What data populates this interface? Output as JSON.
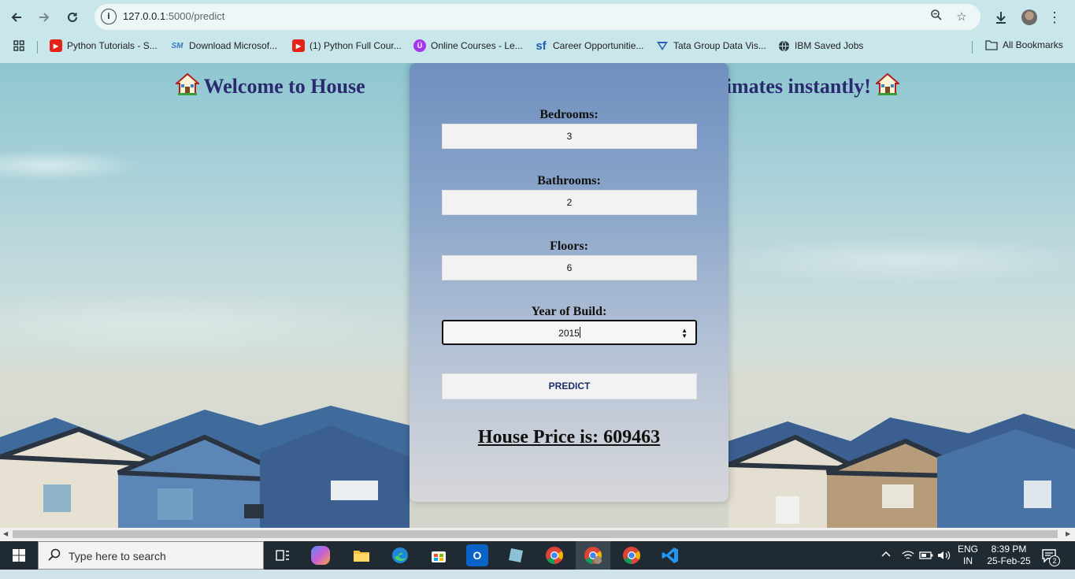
{
  "browser": {
    "url_host": "127.0.0.1",
    "url_path": ":5000/predict",
    "bookmarks": [
      {
        "label": "Python Tutorials - S...",
        "icon": "youtube-icon"
      },
      {
        "label": "Download Microsof...",
        "icon": "sm-icon",
        "icon_text": "SM"
      },
      {
        "label": "(1) Python Full Cour...",
        "icon": "youtube-icon"
      },
      {
        "label": "Online Courses - Le...",
        "icon": "udemy-icon"
      },
      {
        "label": "Career Opportunitie...",
        "icon": "sf-icon",
        "icon_text": "sf"
      },
      {
        "label": "Tata Group Data Vis...",
        "icon": "tata-icon"
      },
      {
        "label": "IBM Saved Jobs",
        "icon": "globe-icon"
      }
    ],
    "all_bookmarks": "All Bookmarks"
  },
  "page": {
    "heading_left": "Welcome to House",
    "heading_right": "ice estimates instantly!",
    "form": {
      "bedrooms_label": "Bedrooms:",
      "bedrooms_value": "3",
      "bathrooms_label": "Bathrooms:",
      "bathrooms_value": "2",
      "floors_label": "Floors:",
      "floors_value": "6",
      "year_label": "Year of Build:",
      "year_value": "2015",
      "predict_label": "PREDICT"
    },
    "result": "House Price is: 609463"
  },
  "taskbar": {
    "search_placeholder": "Type here to search",
    "lang_top": "ENG",
    "lang_bottom": "IN",
    "time": "8:39 PM",
    "date": "25-Feb-25",
    "notifications": "2"
  }
}
